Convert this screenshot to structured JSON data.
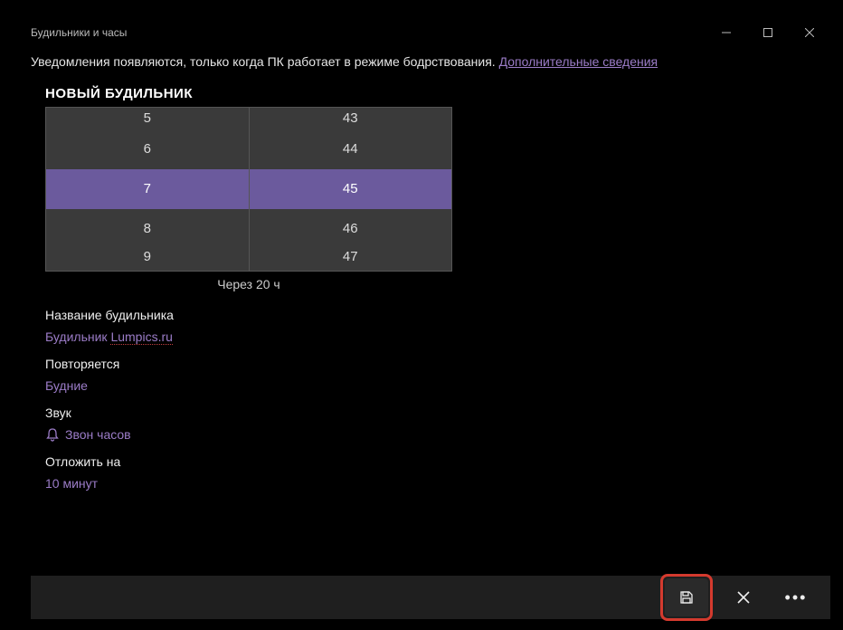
{
  "window": {
    "title": "Будильники и часы"
  },
  "notice": {
    "text": "Уведомления появляются, только когда ПК работает в режиме бодрствования. ",
    "link": "Дополнительные сведения"
  },
  "heading": "НОВЫЙ БУДИЛЬНИК",
  "picker": {
    "hours": [
      "5",
      "6",
      "7",
      "8",
      "9"
    ],
    "minutes": [
      "43",
      "44",
      "45",
      "46",
      "47"
    ],
    "selected_index": 2,
    "time_note": "Через 20 ч"
  },
  "fields": {
    "name_label": "Название будильника",
    "name_value_prefix": "Будильник ",
    "name_value_marked": "Lumpics.ru",
    "repeat_label": "Повторяется",
    "repeat_value": "Будние",
    "sound_label": "Звук",
    "sound_value": "Звон часов",
    "snooze_label": "Отложить на",
    "snooze_value": "10 минут"
  },
  "icons": {
    "save": "save-icon",
    "cancel": "close-icon",
    "more": "more-icon",
    "minimize": "minimize-icon",
    "maximize": "maximize-icon",
    "close": "close-icon",
    "bell": "bell-icon"
  }
}
